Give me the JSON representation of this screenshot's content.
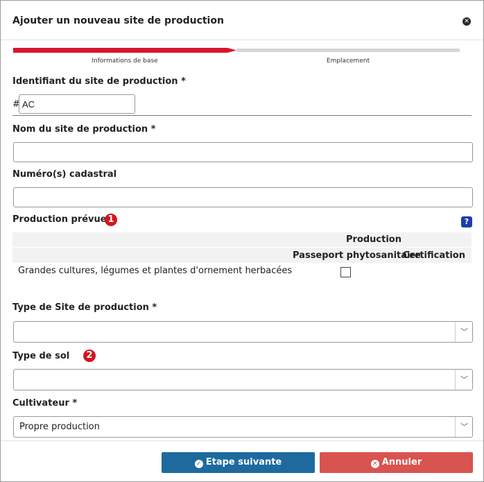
{
  "modal": {
    "title": "Ajouter un nouveau site de production",
    "close_icon": "close-circle-icon"
  },
  "stepper": {
    "steps": [
      {
        "label": "Informations de base",
        "active": true
      },
      {
        "label": "Emplacement",
        "active": false
      }
    ],
    "active_color": "#d9142b",
    "inactive_color": "#d6d6d6"
  },
  "fields": {
    "site_id": {
      "label": "Identifiant du site de production *",
      "prefix": "#",
      "value": "AC"
    },
    "site_name": {
      "label": "Nom du site de production *",
      "value": ""
    },
    "cadastral": {
      "label": "Numéro(s) cadastral",
      "value": ""
    },
    "planned_production": {
      "label": "Production prévue *",
      "badge": "1",
      "help_icon": "question-icon",
      "group_header": "Production",
      "columns": [
        "Passeport phytosanitaire",
        "Certification"
      ],
      "rows": [
        {
          "label": "Grandes cultures, légumes et plantes d'ornement herbacées",
          "passeport_checked": false
        }
      ]
    },
    "site_type": {
      "label": "Type de Site de production *",
      "value": ""
    },
    "soil_type": {
      "label": "Type de sol",
      "badge": "2",
      "value": ""
    },
    "grower": {
      "label": "Cultivateur *",
      "value": "Propre production"
    }
  },
  "footer": {
    "next_label": "Etape suivante",
    "next_icon": "check-circle-icon",
    "cancel_label": "Annuler",
    "cancel_icon": "close-circle-icon",
    "next_color": "#1e6a9f",
    "cancel_color": "#d9534f"
  }
}
